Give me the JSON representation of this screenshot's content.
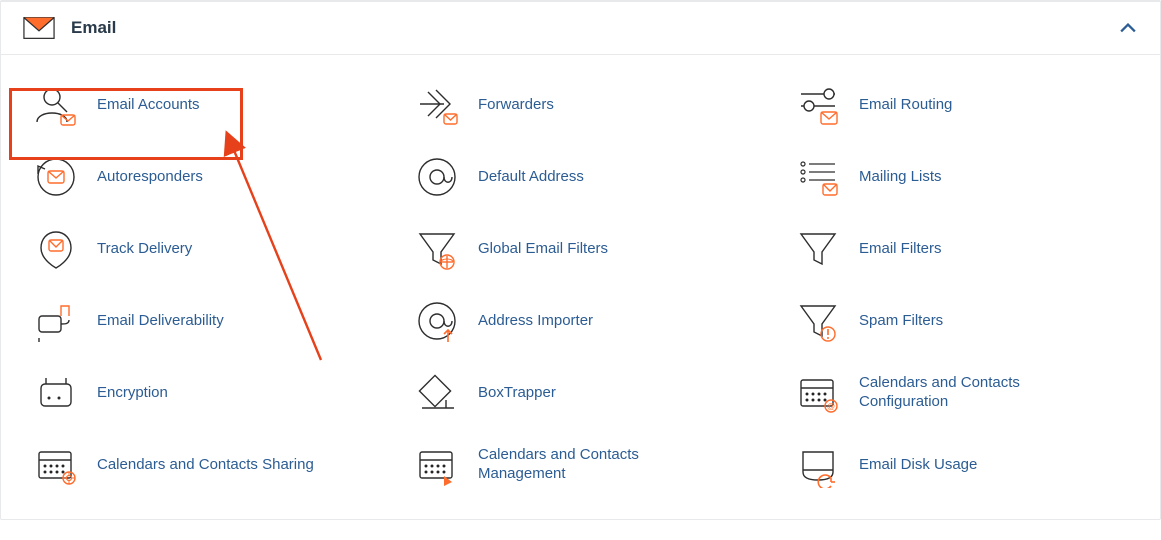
{
  "header": {
    "title": "Email"
  },
  "items": [
    {
      "label": "Email Accounts",
      "highlighted": true
    },
    {
      "label": "Forwarders"
    },
    {
      "label": "Email Routing"
    },
    {
      "label": "Autoresponders"
    },
    {
      "label": "Default Address"
    },
    {
      "label": "Mailing Lists"
    },
    {
      "label": "Track Delivery"
    },
    {
      "label": "Global Email Filters"
    },
    {
      "label": "Email Filters"
    },
    {
      "label": "Email Deliverability"
    },
    {
      "label": "Address Importer"
    },
    {
      "label": "Spam Filters"
    },
    {
      "label": "Encryption"
    },
    {
      "label": "BoxTrapper"
    },
    {
      "label": "Calendars and Contacts Configuration"
    },
    {
      "label": "Calendars and Contacts Sharing"
    },
    {
      "label": "Calendars and Contacts Management"
    },
    {
      "label": "Email Disk Usage"
    }
  ],
  "colors": {
    "accent": "#ff6c2c",
    "icon": "#2d2d2d",
    "link": "#2b5c93"
  }
}
